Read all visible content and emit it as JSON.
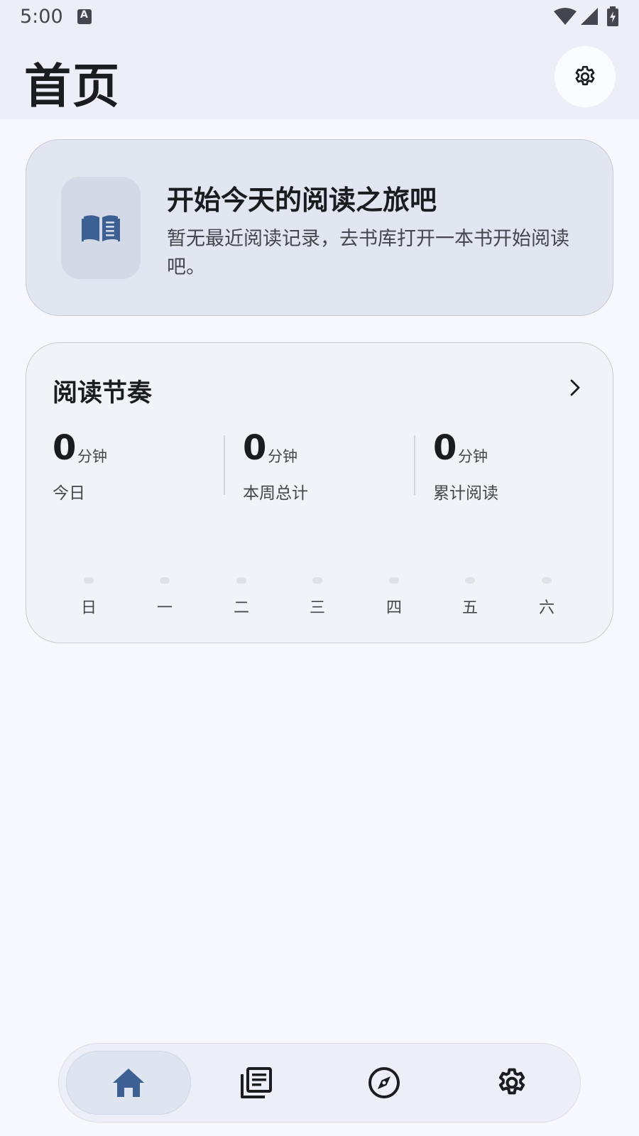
{
  "status_bar": {
    "time": "5:00"
  },
  "header": {
    "title": "首页",
    "settings_icon": "gear-icon"
  },
  "welcome_card": {
    "icon": "book-icon",
    "title": "开始今天的阅读之旅吧",
    "description": "暂无最近阅读记录，去书库打开一本书开始阅读吧。"
  },
  "rhythm_card": {
    "title": "阅读节奏",
    "stats": [
      {
        "value": "0",
        "unit": "分钟",
        "label": "今日"
      },
      {
        "value": "0",
        "unit": "分钟",
        "label": "本周总计"
      },
      {
        "value": "0",
        "unit": "分钟",
        "label": "累计阅读"
      }
    ],
    "days": [
      "日",
      "一",
      "二",
      "三",
      "四",
      "五",
      "六"
    ],
    "day_values": [
      0,
      0,
      0,
      0,
      0,
      0,
      0
    ]
  },
  "bottom_nav": {
    "items": [
      {
        "icon": "home-icon",
        "active": true
      },
      {
        "icon": "library-icon",
        "active": false
      },
      {
        "icon": "compass-icon",
        "active": false
      },
      {
        "icon": "gear-icon",
        "active": false
      }
    ]
  },
  "colors": {
    "accent": "#3c5f94",
    "text_primary": "#1b1c20",
    "text_secondary": "#45464d"
  }
}
